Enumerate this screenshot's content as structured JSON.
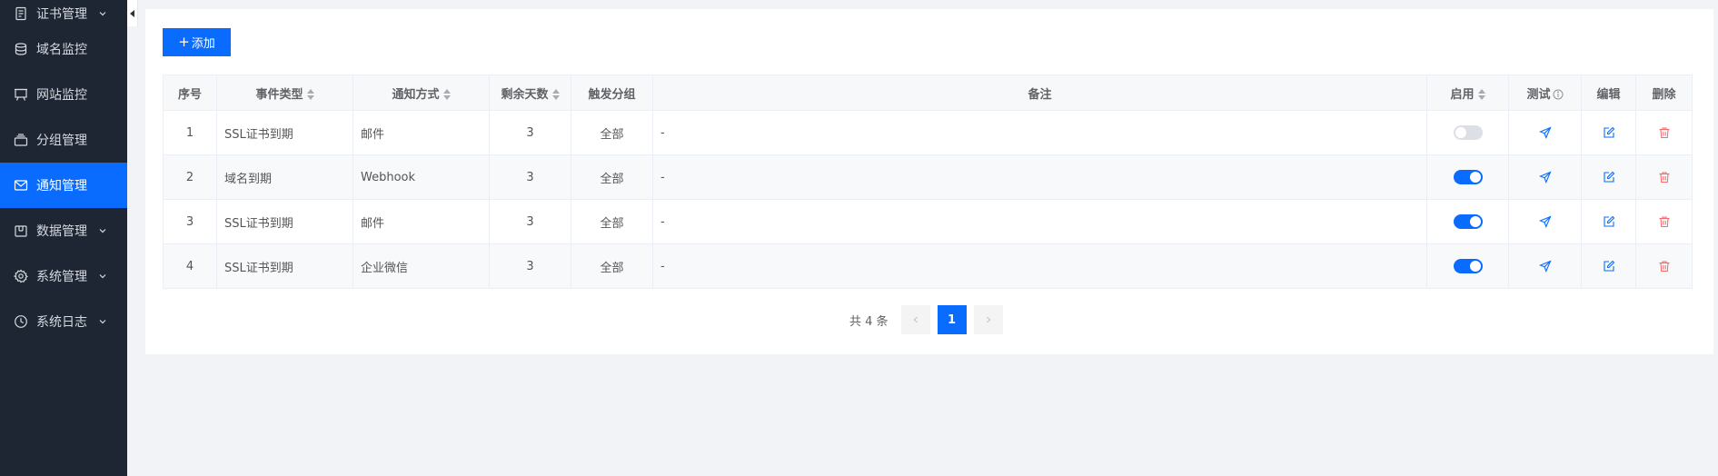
{
  "sidebar": {
    "items": [
      {
        "label": "证书管理",
        "icon": "document-icon",
        "expandable": true,
        "active": false
      },
      {
        "label": "域名监控",
        "icon": "database-icon",
        "expandable": false,
        "active": false
      },
      {
        "label": "网站监控",
        "icon": "presentation-icon",
        "expandable": false,
        "active": false
      },
      {
        "label": "分组管理",
        "icon": "layers-icon",
        "expandable": false,
        "active": false
      },
      {
        "label": "通知管理",
        "icon": "mail-icon",
        "expandable": false,
        "active": true
      },
      {
        "label": "数据管理",
        "icon": "box-icon",
        "expandable": true,
        "active": false
      },
      {
        "label": "系统管理",
        "icon": "gear-icon",
        "expandable": true,
        "active": false
      },
      {
        "label": "系统日志",
        "icon": "clock-icon",
        "expandable": true,
        "active": false
      }
    ]
  },
  "toolbar": {
    "add_label": "添加"
  },
  "table": {
    "headers": {
      "index": "序号",
      "event_type": "事件类型",
      "notify_method": "通知方式",
      "remaining_days": "剩余天数",
      "trigger_group": "触发分组",
      "remark": "备注",
      "enabled": "启用",
      "test": "测试",
      "edit": "编辑",
      "delete": "删除"
    },
    "rows": [
      {
        "index": "1",
        "event_type": "SSL证书到期",
        "notify_method": "邮件",
        "remaining_days": "3",
        "trigger_group": "全部",
        "remark": "-",
        "enabled": false
      },
      {
        "index": "2",
        "event_type": "域名到期",
        "notify_method": "Webhook",
        "remaining_days": "3",
        "trigger_group": "全部",
        "remark": "-",
        "enabled": true
      },
      {
        "index": "3",
        "event_type": "SSL证书到期",
        "notify_method": "邮件",
        "remaining_days": "3",
        "trigger_group": "全部",
        "remark": "-",
        "enabled": true
      },
      {
        "index": "4",
        "event_type": "SSL证书到期",
        "notify_method": "企业微信",
        "remaining_days": "3",
        "trigger_group": "全部",
        "remark": "-",
        "enabled": true
      }
    ]
  },
  "pagination": {
    "total_text": "共 4 条",
    "current_page": "1"
  },
  "colors": {
    "primary": "#0a6cff",
    "sidebar_bg": "#1f2633",
    "danger": "#f56c6c"
  }
}
